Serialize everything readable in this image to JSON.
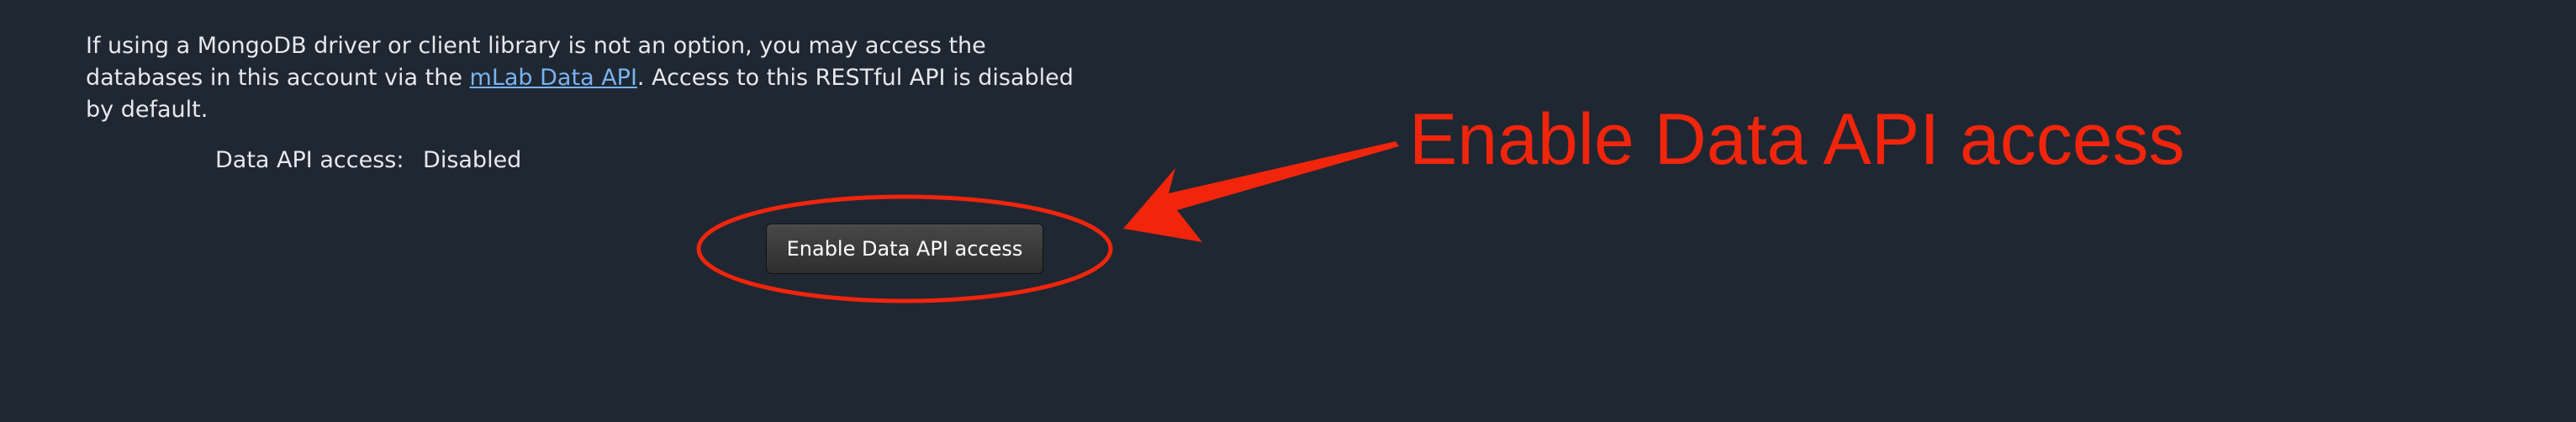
{
  "intro": {
    "text_before": "If using a MongoDB driver or client library is not an option, you may access the databases in this account via the ",
    "link_text": "mLab Data API",
    "text_after": ". Access to this RESTful API is disabled by default."
  },
  "status": {
    "label": "Data API access:",
    "value": "Disabled"
  },
  "button": {
    "label": "Enable Data API access"
  },
  "annotation": {
    "callout_text": "Enable Data API access",
    "color": "#f0250c"
  },
  "colors": {
    "background": "#1f2732",
    "link": "#79b3f0"
  }
}
